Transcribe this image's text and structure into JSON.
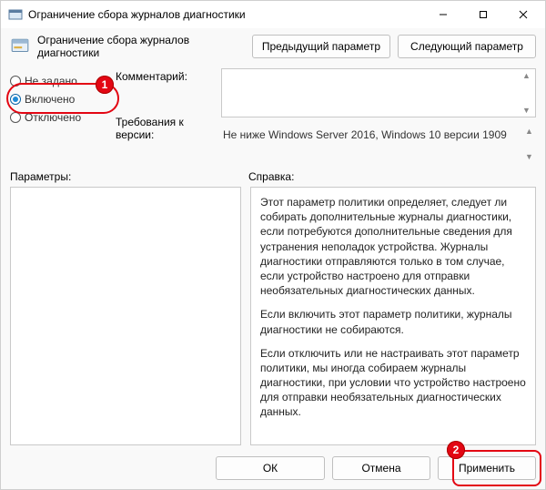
{
  "titlebar": {
    "title": "Ограничение сбора журналов диагностики"
  },
  "header": {
    "label": "Ограничение сбора журналов диагностики",
    "prev": "Предыдущий параметр",
    "next": "Следующий параметр"
  },
  "radios": {
    "not_configured": "Не задано",
    "enabled": "Включено",
    "disabled": "Отключено",
    "selected": "enabled"
  },
  "labels": {
    "comment": "Комментарий:",
    "requirements": "Требования к версии:",
    "parameters": "Параметры:",
    "help": "Справка:"
  },
  "fields": {
    "comment_value": "",
    "requirements_value": "Не ниже Windows Server 2016, Windows 10 версии 1909"
  },
  "help": {
    "p1": "Этот параметр политики определяет, следует ли собирать дополнительные журналы диагностики, если потребуются дополнительные сведения для устранения неполадок устройства. Журналы диагностики отправляются только в том случае, если устройство настроено для отправки необязательных диагностических данных.",
    "p2": "Если включить этот параметр политики, журналы диагностики не собираются.",
    "p3": "Если отключить или не настраивать этот параметр политики, мы иногда собираем журналы диагностики, при условии что устройство настроено для отправки необязательных диагностических данных."
  },
  "footer": {
    "ok": "ОК",
    "cancel": "Отмена",
    "apply": "Применить"
  },
  "callouts": {
    "one": "1",
    "two": "2"
  }
}
